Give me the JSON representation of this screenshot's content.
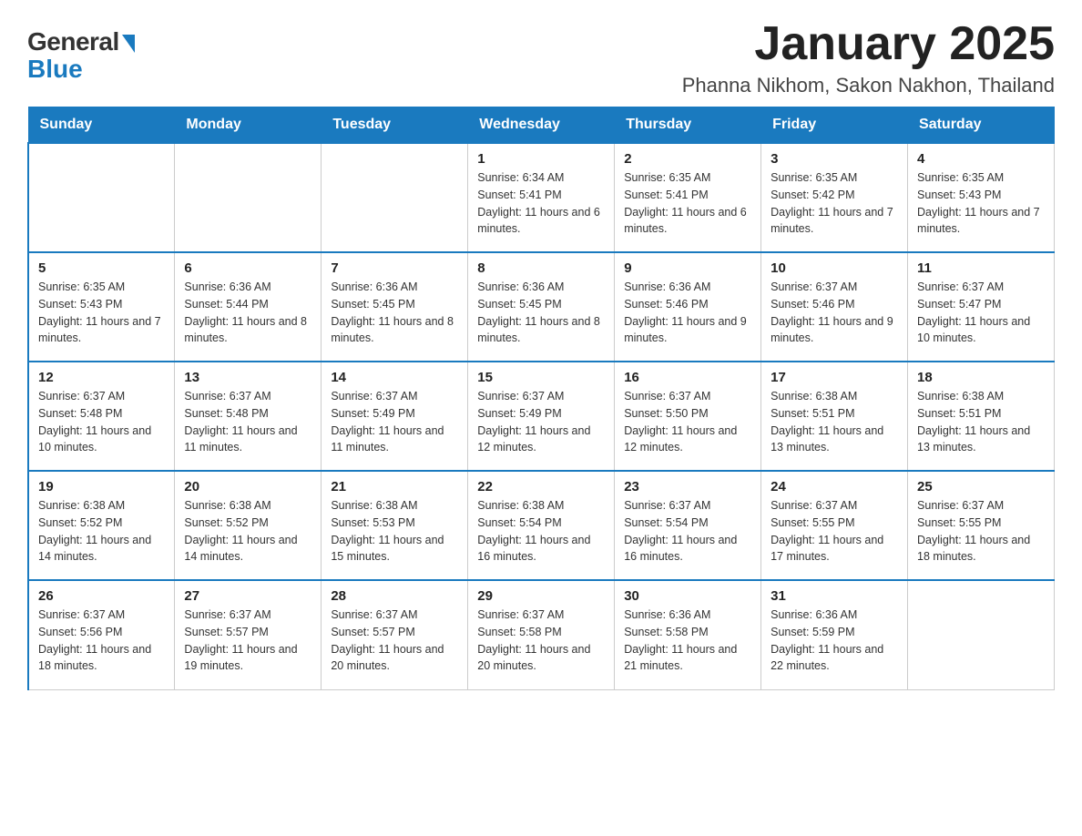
{
  "logo": {
    "general": "General",
    "blue": "Blue"
  },
  "title": "January 2025",
  "subtitle": "Phanna Nikhom, Sakon Nakhon, Thailand",
  "days_of_week": [
    "Sunday",
    "Monday",
    "Tuesday",
    "Wednesday",
    "Thursday",
    "Friday",
    "Saturday"
  ],
  "weeks": [
    [
      {
        "day": "",
        "info": ""
      },
      {
        "day": "",
        "info": ""
      },
      {
        "day": "",
        "info": ""
      },
      {
        "day": "1",
        "info": "Sunrise: 6:34 AM\nSunset: 5:41 PM\nDaylight: 11 hours and 6 minutes."
      },
      {
        "day": "2",
        "info": "Sunrise: 6:35 AM\nSunset: 5:41 PM\nDaylight: 11 hours and 6 minutes."
      },
      {
        "day": "3",
        "info": "Sunrise: 6:35 AM\nSunset: 5:42 PM\nDaylight: 11 hours and 7 minutes."
      },
      {
        "day": "4",
        "info": "Sunrise: 6:35 AM\nSunset: 5:43 PM\nDaylight: 11 hours and 7 minutes."
      }
    ],
    [
      {
        "day": "5",
        "info": "Sunrise: 6:35 AM\nSunset: 5:43 PM\nDaylight: 11 hours and 7 minutes."
      },
      {
        "day": "6",
        "info": "Sunrise: 6:36 AM\nSunset: 5:44 PM\nDaylight: 11 hours and 8 minutes."
      },
      {
        "day": "7",
        "info": "Sunrise: 6:36 AM\nSunset: 5:45 PM\nDaylight: 11 hours and 8 minutes."
      },
      {
        "day": "8",
        "info": "Sunrise: 6:36 AM\nSunset: 5:45 PM\nDaylight: 11 hours and 8 minutes."
      },
      {
        "day": "9",
        "info": "Sunrise: 6:36 AM\nSunset: 5:46 PM\nDaylight: 11 hours and 9 minutes."
      },
      {
        "day": "10",
        "info": "Sunrise: 6:37 AM\nSunset: 5:46 PM\nDaylight: 11 hours and 9 minutes."
      },
      {
        "day": "11",
        "info": "Sunrise: 6:37 AM\nSunset: 5:47 PM\nDaylight: 11 hours and 10 minutes."
      }
    ],
    [
      {
        "day": "12",
        "info": "Sunrise: 6:37 AM\nSunset: 5:48 PM\nDaylight: 11 hours and 10 minutes."
      },
      {
        "day": "13",
        "info": "Sunrise: 6:37 AM\nSunset: 5:48 PM\nDaylight: 11 hours and 11 minutes."
      },
      {
        "day": "14",
        "info": "Sunrise: 6:37 AM\nSunset: 5:49 PM\nDaylight: 11 hours and 11 minutes."
      },
      {
        "day": "15",
        "info": "Sunrise: 6:37 AM\nSunset: 5:49 PM\nDaylight: 11 hours and 12 minutes."
      },
      {
        "day": "16",
        "info": "Sunrise: 6:37 AM\nSunset: 5:50 PM\nDaylight: 11 hours and 12 minutes."
      },
      {
        "day": "17",
        "info": "Sunrise: 6:38 AM\nSunset: 5:51 PM\nDaylight: 11 hours and 13 minutes."
      },
      {
        "day": "18",
        "info": "Sunrise: 6:38 AM\nSunset: 5:51 PM\nDaylight: 11 hours and 13 minutes."
      }
    ],
    [
      {
        "day": "19",
        "info": "Sunrise: 6:38 AM\nSunset: 5:52 PM\nDaylight: 11 hours and 14 minutes."
      },
      {
        "day": "20",
        "info": "Sunrise: 6:38 AM\nSunset: 5:52 PM\nDaylight: 11 hours and 14 minutes."
      },
      {
        "day": "21",
        "info": "Sunrise: 6:38 AM\nSunset: 5:53 PM\nDaylight: 11 hours and 15 minutes."
      },
      {
        "day": "22",
        "info": "Sunrise: 6:38 AM\nSunset: 5:54 PM\nDaylight: 11 hours and 16 minutes."
      },
      {
        "day": "23",
        "info": "Sunrise: 6:37 AM\nSunset: 5:54 PM\nDaylight: 11 hours and 16 minutes."
      },
      {
        "day": "24",
        "info": "Sunrise: 6:37 AM\nSunset: 5:55 PM\nDaylight: 11 hours and 17 minutes."
      },
      {
        "day": "25",
        "info": "Sunrise: 6:37 AM\nSunset: 5:55 PM\nDaylight: 11 hours and 18 minutes."
      }
    ],
    [
      {
        "day": "26",
        "info": "Sunrise: 6:37 AM\nSunset: 5:56 PM\nDaylight: 11 hours and 18 minutes."
      },
      {
        "day": "27",
        "info": "Sunrise: 6:37 AM\nSunset: 5:57 PM\nDaylight: 11 hours and 19 minutes."
      },
      {
        "day": "28",
        "info": "Sunrise: 6:37 AM\nSunset: 5:57 PM\nDaylight: 11 hours and 20 minutes."
      },
      {
        "day": "29",
        "info": "Sunrise: 6:37 AM\nSunset: 5:58 PM\nDaylight: 11 hours and 20 minutes."
      },
      {
        "day": "30",
        "info": "Sunrise: 6:36 AM\nSunset: 5:58 PM\nDaylight: 11 hours and 21 minutes."
      },
      {
        "day": "31",
        "info": "Sunrise: 6:36 AM\nSunset: 5:59 PM\nDaylight: 11 hours and 22 minutes."
      },
      {
        "day": "",
        "info": ""
      }
    ]
  ]
}
